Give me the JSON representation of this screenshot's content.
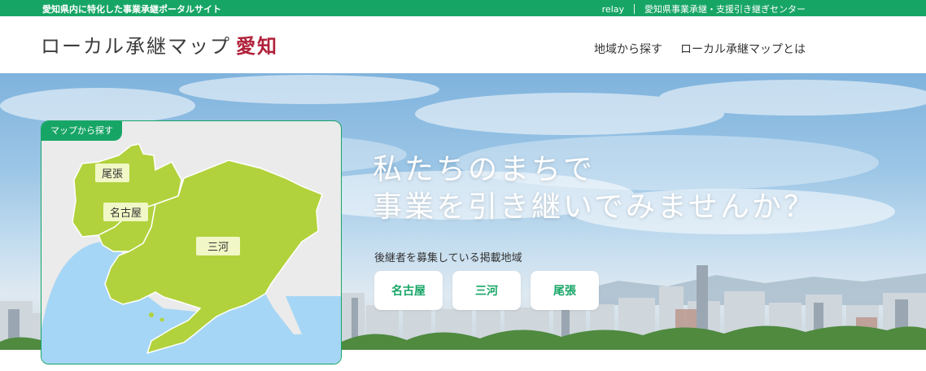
{
  "topbar": {
    "tagline": "愛知県内に特化した事業承継ポータルサイト",
    "links": [
      "relay",
      "愛知県事業承継・支援引き継ぎセンター"
    ]
  },
  "header": {
    "logo_main": "ローカル承継マップ",
    "logo_accent": "愛知",
    "nav": [
      "地域から探す",
      "ローカル承継マップとは"
    ]
  },
  "hero": {
    "headline_line1": "私たちのまちで",
    "headline_line2": "事業を引き継いでみませんか？",
    "regions_caption": "後継者を募集している掲載地域",
    "region_buttons": [
      "名古屋",
      "三河",
      "尾張"
    ]
  },
  "map": {
    "badge": "マップから探す",
    "labels": [
      "尾張",
      "名古屋",
      "三河"
    ]
  },
  "colors": {
    "brand_green": "#17a566",
    "logo_accent": "#b0213a",
    "land": "#b1d23c",
    "water": "#a6d6f5"
  }
}
